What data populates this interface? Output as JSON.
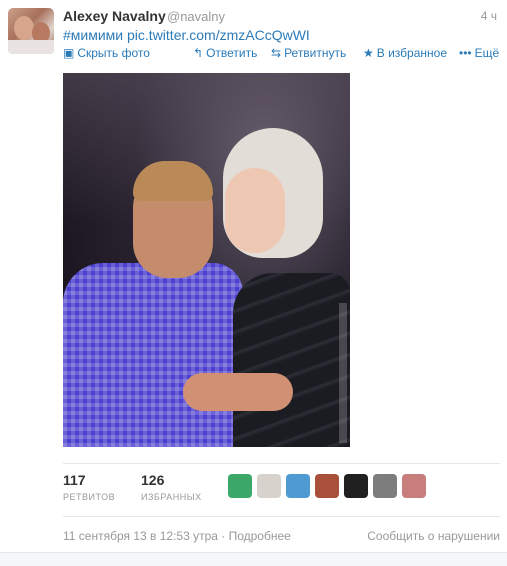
{
  "tweet": {
    "author_name": "Alexey Navalny",
    "handle": "@navalny",
    "time": "4 ч",
    "text": "#мимими pic.twitter.com/zmzACcQwWI"
  },
  "actions": {
    "hide_photo": "Скрыть фото",
    "reply": "Ответить",
    "retweet": "Ретвитнуть",
    "favorite": "В избранное",
    "more": "Ещё"
  },
  "stats": {
    "retweets_count": "117",
    "retweets_label": "РЕТВИТОВ",
    "favorites_count": "126",
    "favorites_label": "ИЗБРАННЫХ"
  },
  "favoriters": [
    {
      "name": "favoriter-1",
      "color": "#3ba86a"
    },
    {
      "name": "favoriter-2",
      "color": "#d8d2cc"
    },
    {
      "name": "favoriter-3",
      "color": "#4f9bd1"
    },
    {
      "name": "favoriter-4",
      "color": "#a8503a"
    },
    {
      "name": "favoriter-5",
      "color": "#202020"
    },
    {
      "name": "favoriter-6",
      "color": "#7d7d7d"
    },
    {
      "name": "favoriter-7",
      "color": "#c97e7e"
    }
  ],
  "footer": {
    "date": "11 сентября 13 в 12:53 утра · Подробнее",
    "report": "Сообщить о нарушении"
  }
}
